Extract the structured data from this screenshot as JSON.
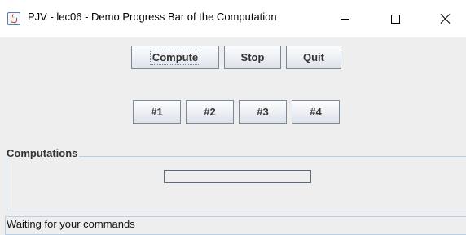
{
  "window": {
    "title": "PJV - lec06 - Demo Progress Bar of the Computation",
    "icon": "java-icon"
  },
  "toolbar": {
    "compute_label": "Compute",
    "stop_label": "Stop",
    "quit_label": "Quit"
  },
  "threads": {
    "buttons": [
      "#1",
      "#2",
      "#3",
      "#4"
    ]
  },
  "computations": {
    "title": "Computations",
    "progress": 0
  },
  "status": {
    "text": "Waiting for your commands"
  }
}
